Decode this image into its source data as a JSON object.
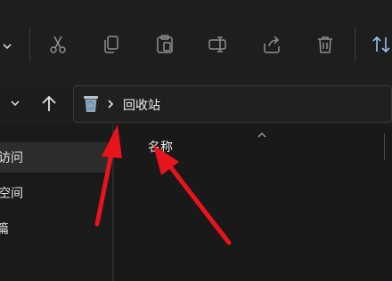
{
  "address_bar": {
    "crumb": "回收站"
  },
  "sidebar": {
    "items": [
      {
        "label": "访问"
      },
      {
        "label": "空间"
      },
      {
        "label": "篇"
      }
    ]
  },
  "file_list": {
    "column_name": "名称",
    "sort": "ascending"
  },
  "annotation_color": "#e8141b",
  "toolbar_icons": [
    "more-chevron-icon",
    "cut-icon",
    "copy-icon",
    "paste-icon",
    "rename-icon",
    "share-icon",
    "delete-icon",
    "sort-icon"
  ]
}
